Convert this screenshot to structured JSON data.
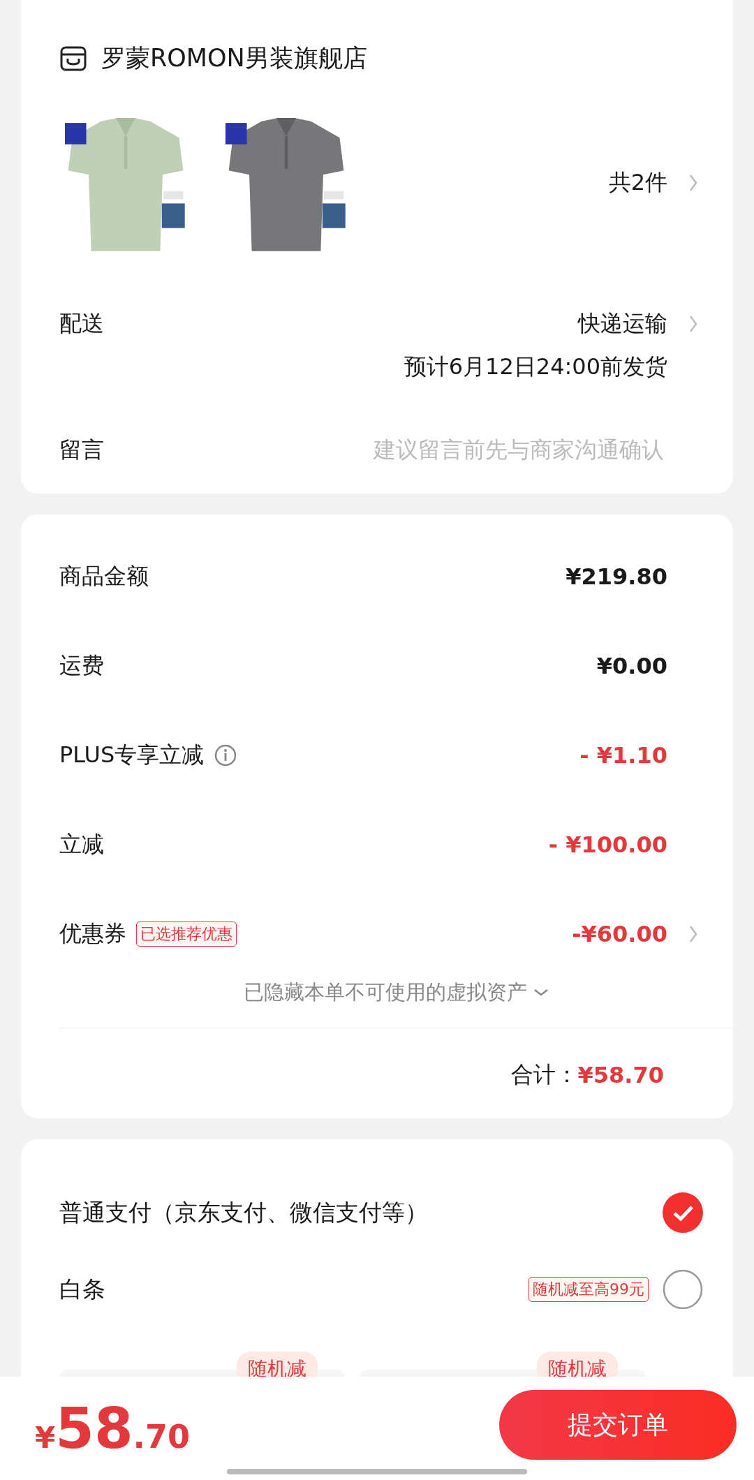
{
  "store": {
    "name": "罗蒙ROMON男装旗舰店"
  },
  "item_count": "共2件",
  "delivery": {
    "label": "配送",
    "method": "快递运输",
    "estimate": "预计6月12日24:00前发货"
  },
  "message": {
    "label": "留言",
    "placeholder": "建议留言前先与商家沟通确认"
  },
  "fees": [
    {
      "label": "商品金额",
      "amount": "¥219.80",
      "kind": "normal"
    },
    {
      "label": "运费",
      "amount": "¥0.00",
      "kind": "normal"
    },
    {
      "label": "PLUS专享立减",
      "amount": "- ¥1.10",
      "kind": "discount",
      "info": true
    },
    {
      "label": "立减",
      "amount": "- ¥100.00",
      "kind": "discount"
    },
    {
      "label": "优惠券",
      "amount": "-¥60.00",
      "kind": "discount",
      "tag": "已选推荐优惠",
      "chevron": true
    }
  ],
  "hidden_assets": "已隐藏本单不可使用的虚拟资产",
  "total": {
    "label": "合计：",
    "amount": "¥58.70"
  },
  "payments": [
    {
      "label": "普通支付（京东支付、微信支付等）",
      "selected": true
    },
    {
      "label": "白条",
      "tag": "随机减至高99元",
      "selected": false
    }
  ],
  "installment_tags": [
    "随机减",
    "随机减"
  ],
  "bottom": {
    "currency": "¥",
    "integer": "58",
    "decimal": ".70",
    "submit": "提交订单"
  }
}
